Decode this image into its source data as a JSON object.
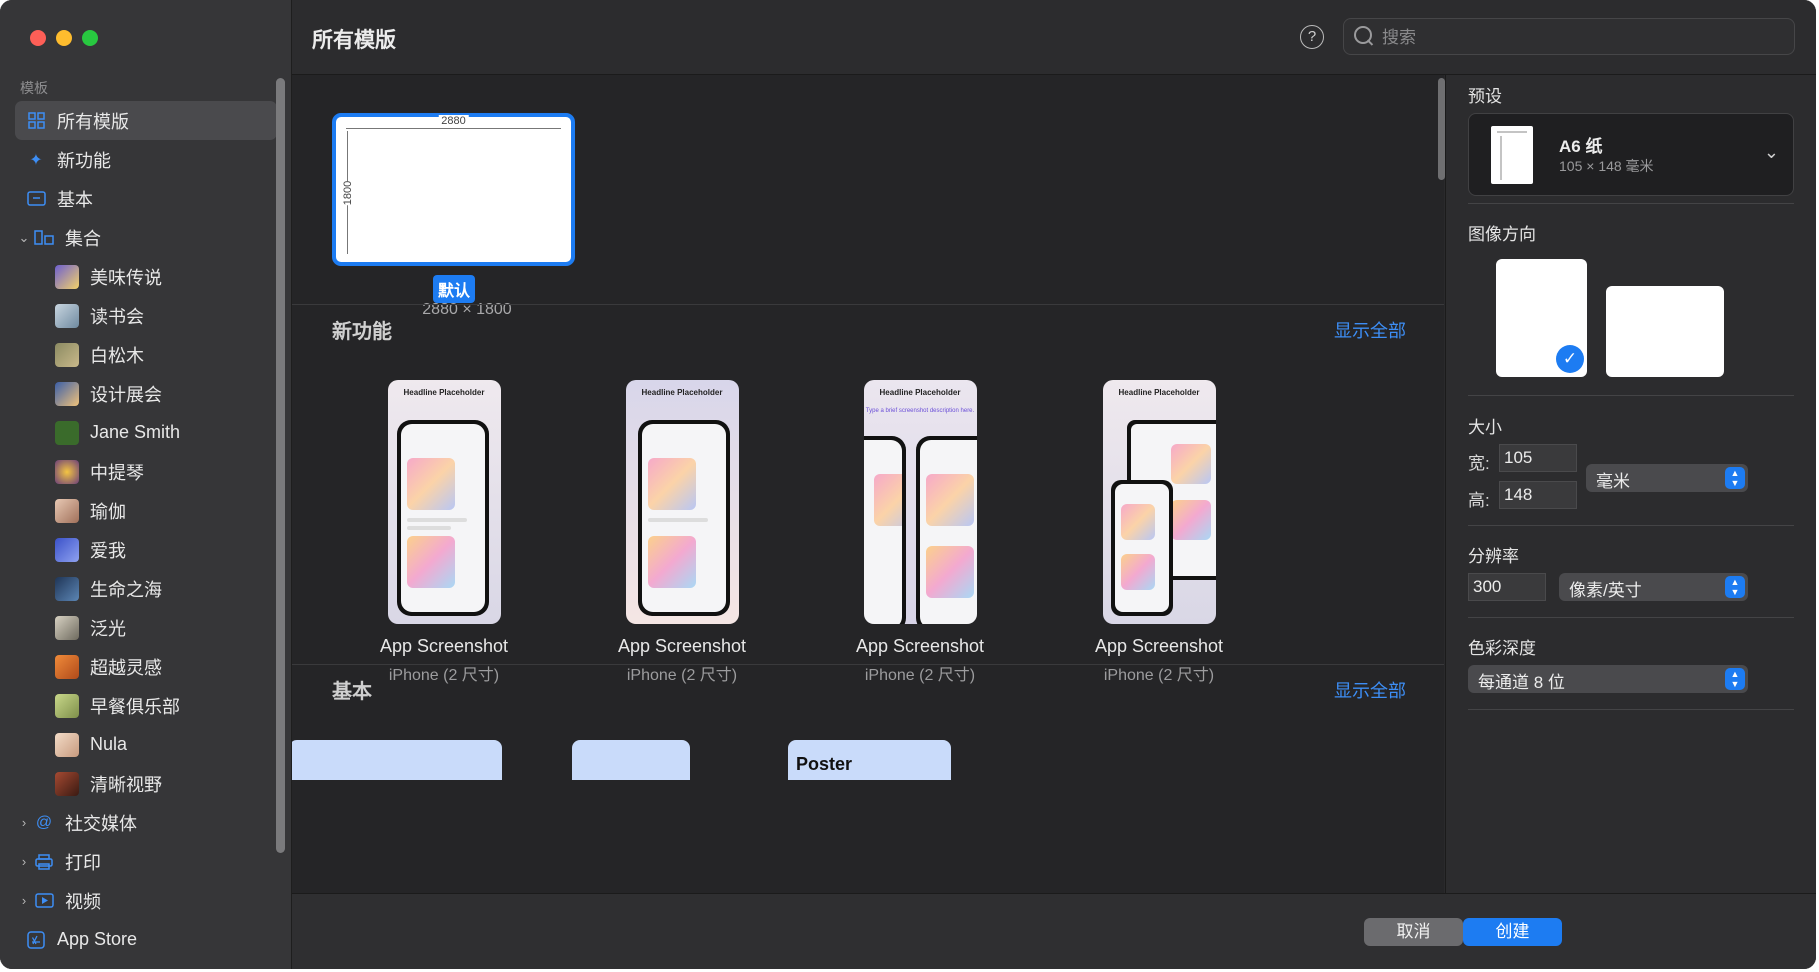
{
  "sidebar": {
    "section_label": "模板",
    "items": [
      {
        "label": "所有模版",
        "icon": "grid-icon"
      },
      {
        "label": "新功能",
        "icon": "sparkle-icon"
      },
      {
        "label": "基本",
        "icon": "basic-icon"
      },
      {
        "label": "集合",
        "icon": "collection-icon"
      }
    ],
    "collections": [
      {
        "label": "美味传说",
        "color": "#6d5fd0"
      },
      {
        "label": "读书会",
        "color": "#8aa4b8"
      },
      {
        "label": "白松木",
        "color": "#8b8a62"
      },
      {
        "label": "设计展会",
        "color": "#c99a55"
      },
      {
        "label": "Jane Smith",
        "color": "#3a6b2b"
      },
      {
        "label": "中提琴",
        "color": "#6b3f7a"
      },
      {
        "label": "瑜伽",
        "color": "#d7a98e"
      },
      {
        "label": "爱我",
        "color": "#3b52c9"
      },
      {
        "label": "生命之海",
        "color": "#2d4f7a"
      },
      {
        "label": "泛光",
        "color": "#9c9584"
      },
      {
        "label": "超越灵感",
        "color": "#d26c2d"
      },
      {
        "label": "早餐俱乐部",
        "color": "#a7b86a"
      },
      {
        "label": "Nula",
        "color": "#e0c2a8"
      },
      {
        "label": "清晰视野",
        "color": "#7a3a2a"
      }
    ],
    "groups": [
      {
        "label": "社交媒体",
        "icon": "at-icon"
      },
      {
        "label": "打印",
        "icon": "printer-icon"
      },
      {
        "label": "视频",
        "icon": "video-icon"
      },
      {
        "label": "App Store",
        "icon": "app-store-icon"
      }
    ]
  },
  "header": {
    "title": "所有模版",
    "search_placeholder": "搜索"
  },
  "main": {
    "default_card": {
      "width_label": "2880",
      "height_label": "1800",
      "badge": "默认",
      "size": "2880 × 1800"
    },
    "sections": [
      {
        "title": "新功能",
        "show_all": "显示全部"
      },
      {
        "title": "基本",
        "show_all": "显示全部"
      }
    ],
    "templates": [
      {
        "name": "App Screenshot",
        "sub": "iPhone (2 尺寸)",
        "headline": "Headline Placeholder"
      },
      {
        "name": "App Screenshot",
        "sub": "iPhone (2 尺寸)",
        "headline": "Headline Placeholder"
      },
      {
        "name": "App Screenshot",
        "sub": "iPhone (2 尺寸)",
        "headline": "Headline Placeholder",
        "desc": "Type a brief screenshot description here."
      },
      {
        "name": "App Screenshot",
        "sub": "iPhone (2 尺寸)",
        "headline": "Headline Placeholder"
      }
    ],
    "basic_poster_label": "Poster"
  },
  "panel": {
    "preset_label": "预设",
    "preset_name": "A6 纸",
    "preset_dim": "105 × 148 毫米",
    "orientation_label": "图像方向",
    "size_label": "大小",
    "width_label": "宽:",
    "width_value": "105",
    "height_label": "高:",
    "height_value": "148",
    "unit": "毫米",
    "resolution_label": "分辨率",
    "resolution_value": "300",
    "resolution_unit": "像素/英寸",
    "color_depth_label": "色彩深度",
    "color_depth_value": "每通道 8 位"
  },
  "footer": {
    "cancel": "取消",
    "create": "创建"
  },
  "colors": {
    "accent": "#1d7cf2",
    "sidebar_bg": "#363638",
    "main_bg": "#252527"
  }
}
